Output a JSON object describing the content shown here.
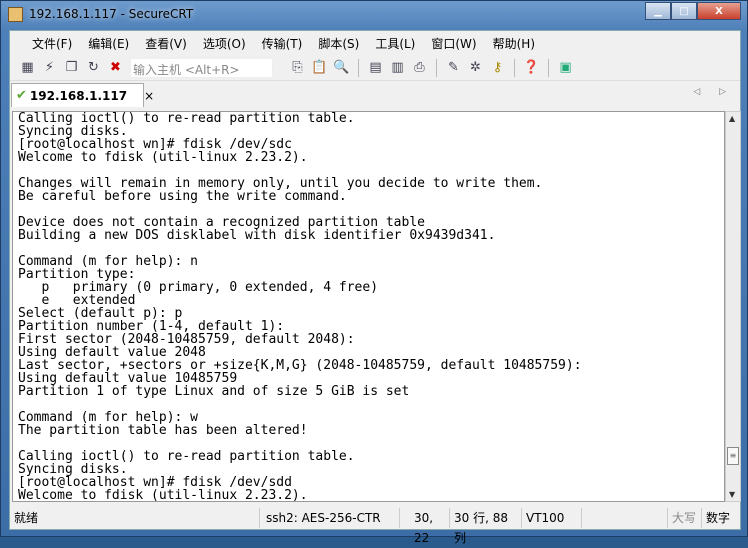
{
  "window": {
    "title": "192.168.1.117 - SecureCRT",
    "minimize": "▁",
    "maximize": "□",
    "close": "X"
  },
  "menu": [
    "文件(F)",
    "编辑(E)",
    "查看(V)",
    "选项(O)",
    "传输(T)",
    "脚本(S)",
    "工具(L)",
    "窗口(W)",
    "帮助(H)"
  ],
  "toolbar": {
    "host_placeholder": "输入主机 <Alt+R>",
    "icons_left": [
      "connect-icon",
      "quick-connect-icon",
      "connect-in-tab-icon",
      "reconnect-icon",
      "disconnect-icon"
    ],
    "icons_right": [
      "copy-icon",
      "paste-icon",
      "find-icon",
      "print-icon",
      "print-selection-icon",
      "printer-icon",
      "session-options-icon",
      "global-options-icon",
      "keymap-icon",
      "help-icon",
      "sftp-icon"
    ]
  },
  "tab": {
    "label": "192.168.1.117",
    "close": "×",
    "nav": "◁ ▷"
  },
  "terminal": {
    "lines": [
      "Calling ioctl() to re-read partition table.",
      "Syncing disks.",
      "[root@localhost wn]# fdisk /dev/sdc",
      "Welcome to fdisk (util-linux 2.23.2).",
      "",
      "Changes will remain in memory only, until you decide to write them.",
      "Be careful before using the write command.",
      "",
      "Device does not contain a recognized partition table",
      "Building a new DOS disklabel with disk identifier 0x9439d341.",
      "",
      "Command (m for help): n",
      "Partition type:",
      "   p   primary (0 primary, 0 extended, 4 free)",
      "   e   extended",
      "Select (default p): p",
      "Partition number (1-4, default 1):",
      "First sector (2048-10485759, default 2048):",
      "Using default value 2048",
      "Last sector, +sectors or +size{K,M,G} (2048-10485759, default 10485759):",
      "Using default value 10485759",
      "Partition 1 of type Linux and of size 5 GiB is set",
      "",
      "Command (m for help): w",
      "The partition table has been altered!",
      "",
      "Calling ioctl() to re-read partition table.",
      "Syncing disks.",
      "[root@localhost wn]# fdisk /dev/sdd",
      "Welcome to fdisk (util-linux 2.23.2)."
    ]
  },
  "status": {
    "ready": "就绪",
    "cipher": "ssh2: AES-256-CTR",
    "cursor": "30,  22",
    "size": "30 行, 88 列",
    "emulation": "VT100",
    "caps": "大写",
    "num": "数字"
  }
}
